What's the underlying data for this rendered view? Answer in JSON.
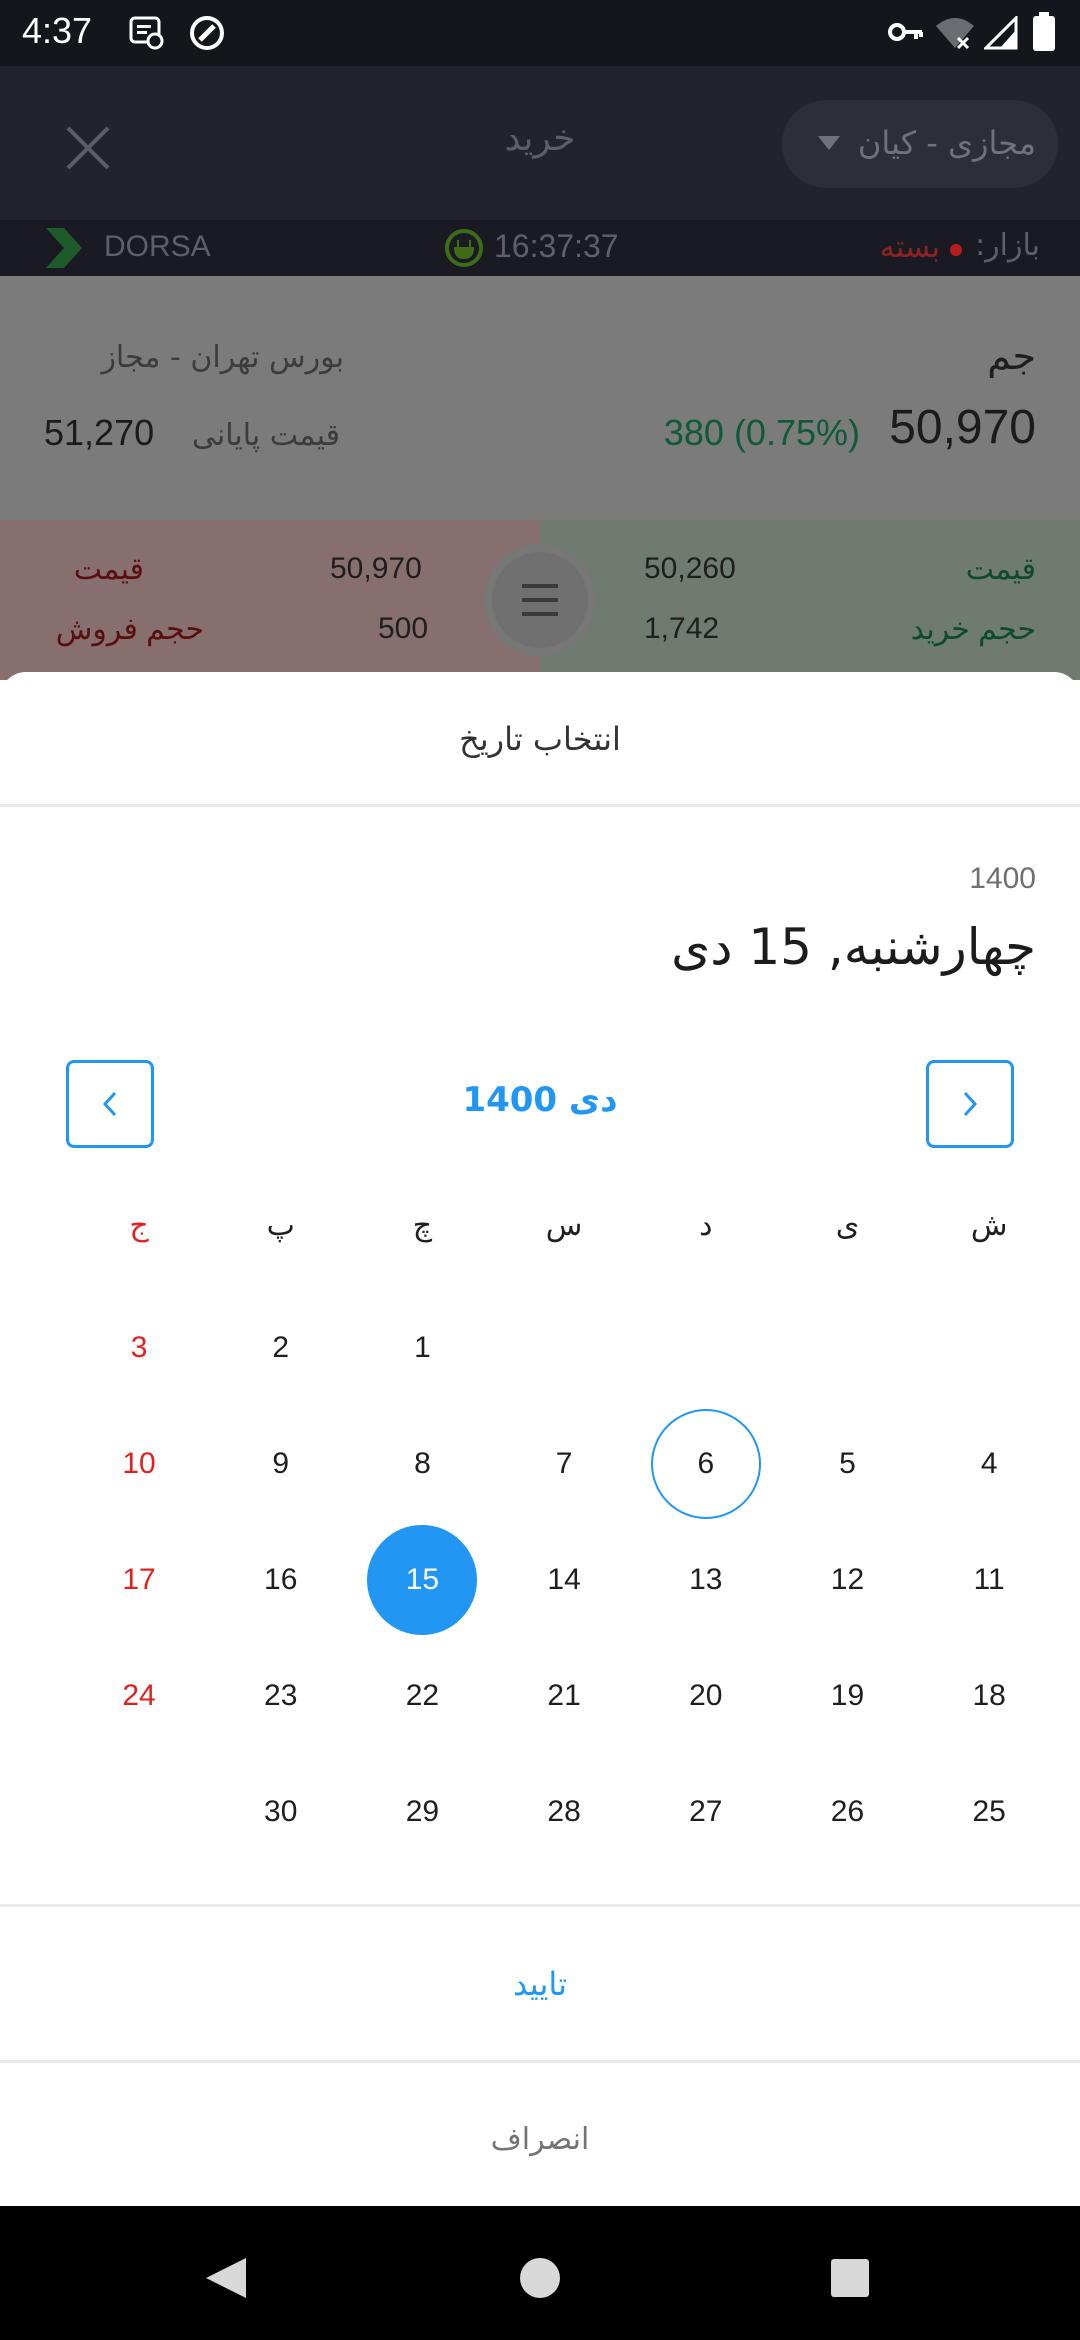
{
  "status_bar": {
    "time": "4:37",
    "icons": [
      "screen-record-icon",
      "no-entry-icon",
      "key-icon",
      "wifi-off-icon",
      "signal-icon",
      "battery-icon"
    ]
  },
  "header": {
    "title": "خرید",
    "account": "مجازی - کیان"
  },
  "ticker": {
    "brand": "DORSA",
    "clock": "16:37:37",
    "market_label": "بازار:",
    "market_status": "بسته"
  },
  "quote": {
    "symbol": "جم",
    "exchange": "بورس تهران - مجاز",
    "last_price": "50,970",
    "change": "380 (0.75%)",
    "close_price_label": "قیمت پایانی",
    "close_price": "51,270"
  },
  "order_book": {
    "buy_price_label": "قیمت",
    "buy_price": "50,260",
    "buy_volume_label": "حجم خرید",
    "buy_volume": "1,742",
    "sell_price_label": "قیمت",
    "sell_price": "50,970",
    "sell_volume_label": "حجم فروش",
    "sell_volume": "500"
  },
  "date_picker": {
    "title": "انتخاب تاریخ",
    "selected_year": "1400",
    "selected_date": "چهارشنبه, 15 دی",
    "month_title": "دی 1400",
    "weekdays": [
      "ش",
      "ی",
      "د",
      "س",
      "چ",
      "پ",
      "ج"
    ],
    "weeks": [
      [
        "",
        "",
        "",
        "",
        "1",
        "2",
        "3"
      ],
      [
        "4",
        "5",
        "6",
        "7",
        "8",
        "9",
        "10"
      ],
      [
        "11",
        "12",
        "13",
        "14",
        "15",
        "16",
        "17"
      ],
      [
        "18",
        "19",
        "20",
        "21",
        "22",
        "23",
        "24"
      ],
      [
        "25",
        "26",
        "27",
        "28",
        "29",
        "30",
        ""
      ]
    ],
    "today": "6",
    "selected_day": "15",
    "confirm_label": "تایید",
    "cancel_label": "انصراف"
  },
  "colors": {
    "accent": "#2196f3",
    "holiday": "#e32020",
    "positive": "#2e9e6a",
    "negative": "#d32f2f"
  }
}
